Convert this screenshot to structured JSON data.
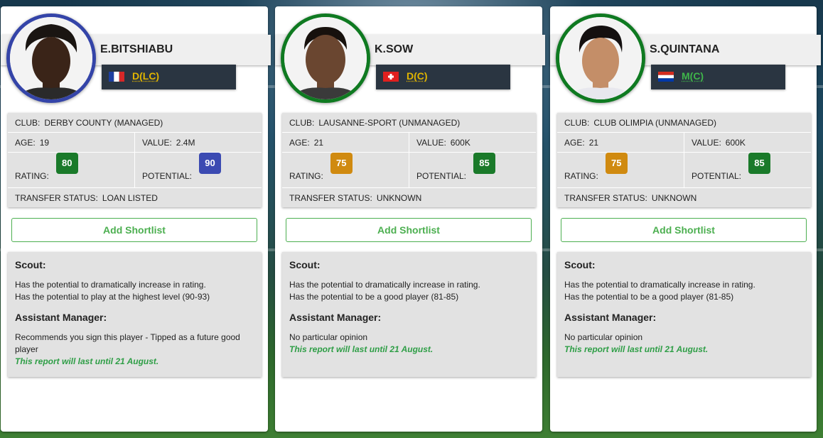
{
  "cards": [
    {
      "name": "E.BITSHIABU",
      "position": "D(LC)",
      "flag": "france",
      "club_label": "CLUB:",
      "club": "DERBY COUNTY (MANAGED)",
      "age_label": "AGE:",
      "age": "19",
      "value_label": "VALUE:",
      "value": "2.4M",
      "rating_label": "RATING:",
      "rating": "80",
      "potential_label": "POTENTIAL:",
      "potential": "90",
      "transfer_label": "TRANSFER STATUS:",
      "transfer": "LOAN LISTED",
      "shortlist": "Add Shortlist",
      "scout_heading": "Scout:",
      "scout_line1": "Has the potential to dramatically increase in rating.",
      "scout_line2": "Has the potential to play at the highest level (90-93)",
      "am_heading": "Assistant Manager:",
      "am_text": "Recommends you sign this player - Tipped as a future good player",
      "until": "This report will last until 21 August."
    },
    {
      "name": "K.SOW",
      "position": "D(C)",
      "flag": "switzerland",
      "club_label": "CLUB:",
      "club": "LAUSANNE-SPORT (UNMANAGED)",
      "age_label": "AGE:",
      "age": "21",
      "value_label": "VALUE:",
      "value": "600K",
      "rating_label": "RATING:",
      "rating": "75",
      "potential_label": "POTENTIAL:",
      "potential": "85",
      "transfer_label": "TRANSFER STATUS:",
      "transfer": "UNKNOWN",
      "shortlist": "Add Shortlist",
      "scout_heading": "Scout:",
      "scout_line1": "Has the potential to dramatically increase in rating.",
      "scout_line2": "Has the potential to be a good player (81-85)",
      "am_heading": "Assistant Manager:",
      "am_text": "No particular opinion",
      "until": "This report will last until 21 August."
    },
    {
      "name": "S.QUINTANA",
      "position": "M(C)",
      "flag": "paraguay",
      "club_label": "CLUB:",
      "club": "CLUB OLIMPIA (UNMANAGED)",
      "age_label": "AGE:",
      "age": "21",
      "value_label": "VALUE:",
      "value": "600K",
      "rating_label": "RATING:",
      "rating": "75",
      "potential_label": "POTENTIAL:",
      "potential": "85",
      "transfer_label": "TRANSFER STATUS:",
      "transfer": "UNKNOWN",
      "shortlist": "Add Shortlist",
      "scout_heading": "Scout:",
      "scout_line1": "Has the potential to dramatically increase in rating.",
      "scout_line2": "Has the potential to be a good player (81-85)",
      "am_heading": "Assistant Manager:",
      "am_text": "No particular opinion",
      "until": "This report will last until 21 August."
    }
  ],
  "colors": {
    "defender_position": "#e0b400",
    "midfielder_position": "#3fb54a",
    "rating_green": "#1a7a2a",
    "rating_amber": "#d08a10",
    "potential_blue": "#3b4ab2",
    "ring_blue": "#3444a8",
    "ring_green": "#0f7a21",
    "action_green": "#4caf50"
  }
}
